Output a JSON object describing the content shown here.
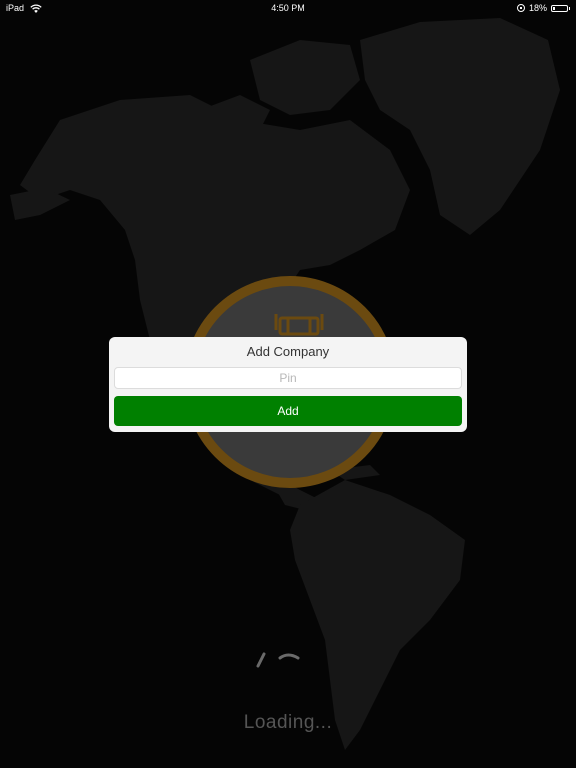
{
  "status_bar": {
    "device": "iPad",
    "time": "4:50 PM",
    "battery_text": "18%",
    "battery_level": 0.18
  },
  "dialog": {
    "title": "Add Company",
    "pin_placeholder": "Pin",
    "pin_value": "",
    "add_label": "Add"
  },
  "loading": {
    "text": "Loading..."
  },
  "colors": {
    "add_button": "#008000",
    "logo_ring": "#6b4a10",
    "dialog_bg": "#f4f4f4"
  },
  "icons": [
    "wifi-icon",
    "orientation-lock-icon",
    "battery-icon",
    "truck-icon",
    "spinner-icon",
    "world-map"
  ]
}
